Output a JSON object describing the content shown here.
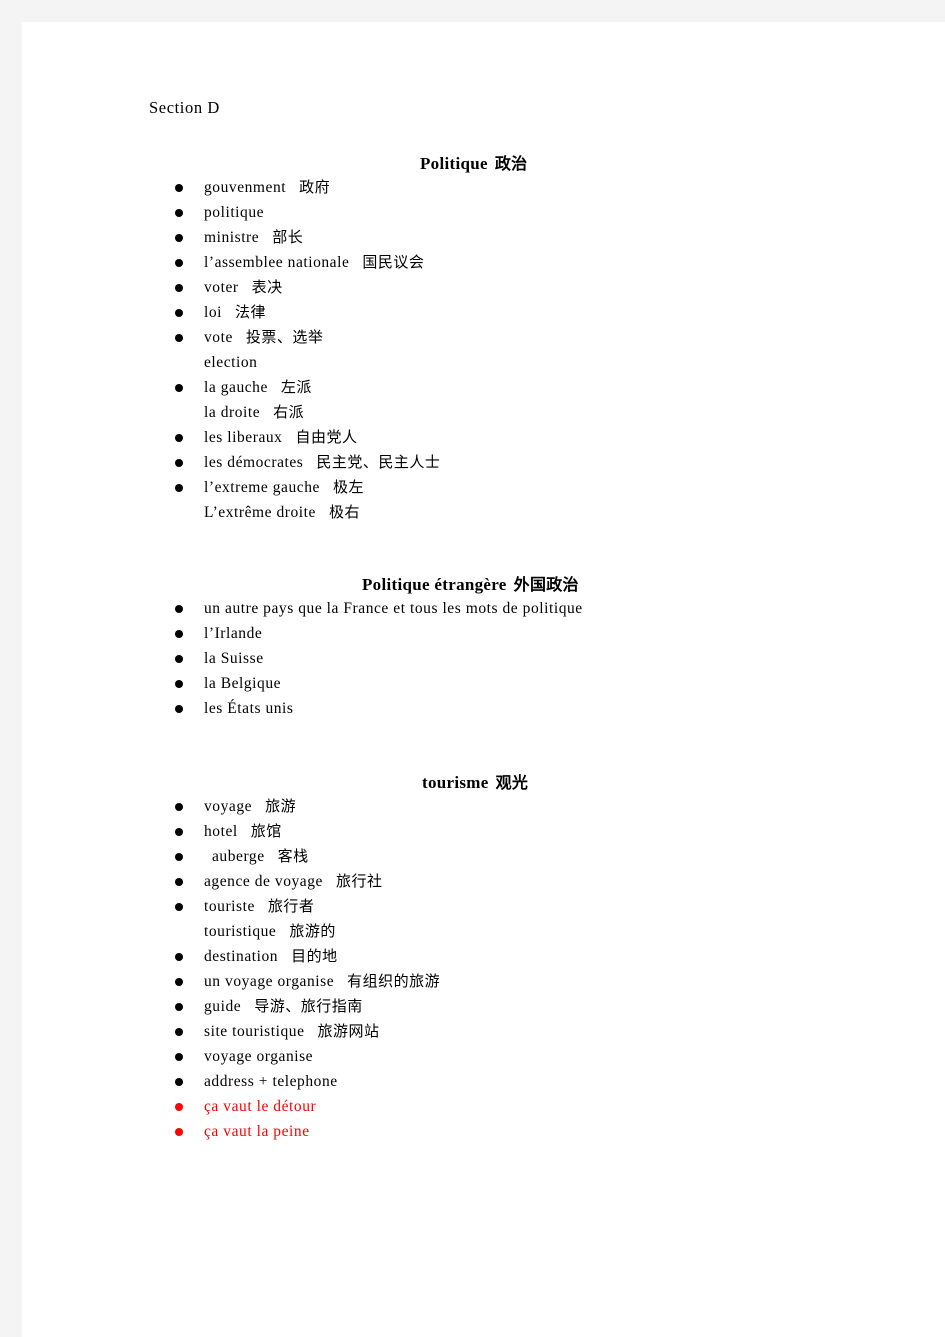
{
  "document": {
    "label": "Section D"
  },
  "sections": [
    {
      "id": "politique",
      "heading_fr": "Politique",
      "heading_zh": "政治",
      "items": [
        {
          "fr": "gouvenment",
          "zh": "政府",
          "bullet": true,
          "color": "black"
        },
        {
          "fr": "politique",
          "zh": "",
          "bullet": true,
          "color": "black"
        },
        {
          "fr": "ministre",
          "zh": "部长",
          "bullet": true,
          "color": "black"
        },
        {
          "fr": "l’assemblee nationale",
          "zh": "国民议会",
          "bullet": true,
          "color": "black"
        },
        {
          "fr": "voter",
          "zh": "表决",
          "bullet": true,
          "color": "black"
        },
        {
          "fr": "loi",
          "zh": "法律",
          "bullet": true,
          "color": "black"
        },
        {
          "fr": "vote",
          "zh": "投票、选举",
          "bullet": true,
          "color": "black"
        },
        {
          "fr": "election",
          "zh": "",
          "bullet": false,
          "color": "black"
        },
        {
          "fr": "la gauche",
          "zh": "左派",
          "bullet": true,
          "color": "black"
        },
        {
          "fr": "la droite",
          "zh": "右派",
          "bullet": false,
          "color": "black"
        },
        {
          "fr": "les liberaux",
          "zh": "自由党人",
          "bullet": true,
          "color": "black"
        },
        {
          "fr": "les démocrates",
          "zh": "民主党、民主人士",
          "bullet": true,
          "color": "black"
        },
        {
          "fr": "l’extreme gauche",
          "zh": "极左",
          "bullet": true,
          "color": "black"
        },
        {
          "fr": "L’extrême droite",
          "zh": "极右",
          "bullet": false,
          "color": "black"
        }
      ]
    },
    {
      "id": "politique-etrangere",
      "heading_fr": "Politique étrangère",
      "heading_zh": "外国政治",
      "items": [
        {
          "fr": "un autre pays que la France et tous les mots de politique",
          "zh": "",
          "bullet": true,
          "color": "black"
        },
        {
          "fr": "l’Irlande",
          "zh": "",
          "bullet": true,
          "color": "black"
        },
        {
          "fr": "la Suisse",
          "zh": "",
          "bullet": true,
          "color": "black"
        },
        {
          "fr": "la Belgique",
          "zh": "",
          "bullet": true,
          "color": "black"
        },
        {
          "fr": "les États unis",
          "zh": "",
          "bullet": true,
          "color": "black"
        }
      ]
    },
    {
      "id": "tourisme",
      "heading_fr": "tourisme",
      "heading_zh": "观光",
      "items": [
        {
          "fr": "voyage",
          "zh": "旅游",
          "bullet": true,
          "color": "black"
        },
        {
          "fr": "hotel",
          "zh": "旅馆",
          "bullet": true,
          "color": "black"
        },
        {
          "fr": "auberge",
          "zh": "客栈",
          "bullet": true,
          "color": "black",
          "indent": true
        },
        {
          "fr": "agence de voyage",
          "zh": "旅行社",
          "bullet": true,
          "color": "black"
        },
        {
          "fr": "touriste",
          "zh": "旅行者",
          "bullet": true,
          "color": "black"
        },
        {
          "fr": "touristique",
          "zh": "旅游的",
          "bullet": false,
          "color": "black"
        },
        {
          "fr": "destination",
          "zh": "目的地",
          "bullet": true,
          "color": "black"
        },
        {
          "fr": "un voyage organise",
          "zh": "有组织的旅游",
          "bullet": true,
          "color": "black"
        },
        {
          "fr": "guide",
          "zh": "导游、旅行指南",
          "bullet": true,
          "color": "black"
        },
        {
          "fr": "site touristique",
          "zh": "旅游网站",
          "bullet": true,
          "color": "black"
        },
        {
          "fr": "voyage organise",
          "zh": "",
          "bullet": true,
          "color": "black"
        },
        {
          "fr": "address + telephone",
          "zh": "",
          "bullet": true,
          "color": "black"
        },
        {
          "fr": "ça vaut le détour",
          "zh": "",
          "bullet": true,
          "color": "red"
        },
        {
          "fr": "ça vaut la peine",
          "zh": "",
          "bullet": true,
          "color": "red"
        }
      ]
    }
  ],
  "colors": {
    "text": "#000000",
    "highlight": "#ff0000",
    "page": "#ffffff",
    "gutter": "#f4f4f4"
  }
}
